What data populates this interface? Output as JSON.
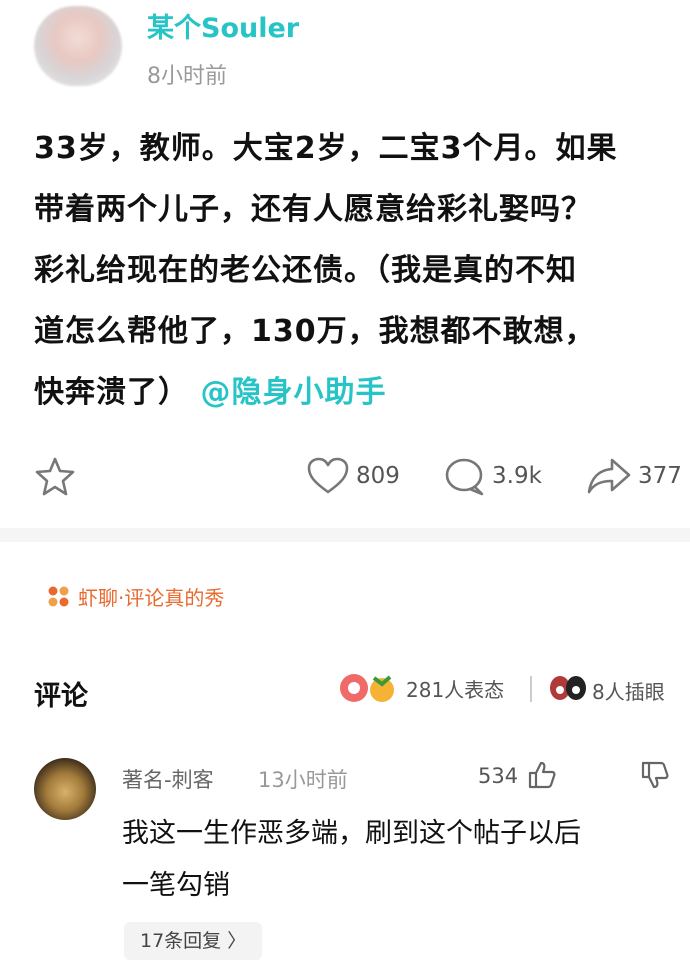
{
  "post": {
    "username": "某个Souler",
    "time": "8小时前",
    "text_lines": [
      "33岁，教师。大宝2岁，二宝3个月。如果",
      "带着两个儿子，还有人愿意给彩礼娶吗？",
      "彩礼给现在的老公还债。（我是真的不知",
      "道怎么帮他了，130万，我想都不敢想，",
      "快奔溃了）"
    ],
    "mention": "@隐身小助手"
  },
  "actions": {
    "likes": "809",
    "comments": "3.9k",
    "shares": "377"
  },
  "topic": "虾聊·评论真的秀",
  "comments_section": {
    "title": "评论",
    "reactions": "281人表态",
    "inserts": "8人插眼"
  },
  "comment": {
    "name": "著名-刺客",
    "time": "13小时前",
    "likes": "534",
    "text_lines": [
      "我这一生作恶多端，刷到这个帖子以后",
      "一笔勾销"
    ],
    "replies": "17条回复 〉"
  },
  "colors": {
    "accent": "#26c3c7",
    "topic": "#e96a2f"
  }
}
